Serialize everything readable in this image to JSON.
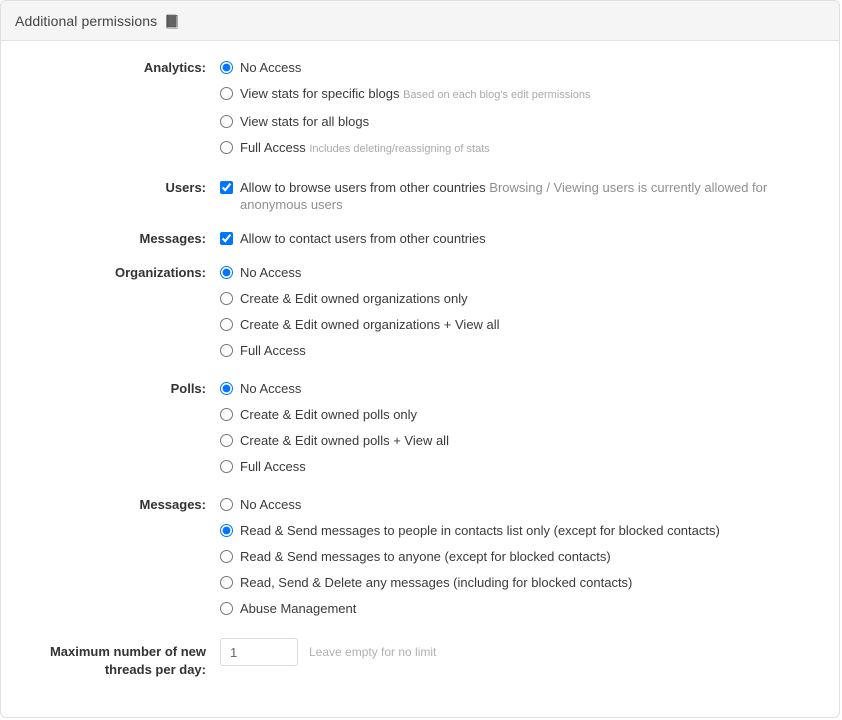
{
  "panel": {
    "title": "Additional permissions",
    "title_icon": "book-icon",
    "title_icon_glyph": "📕"
  },
  "groups": [
    {
      "label": "Analytics:",
      "type": "radio",
      "name": "analytics",
      "options": [
        {
          "text": "No Access",
          "hint": "",
          "checked": true
        },
        {
          "text": "View stats for specific blogs",
          "hint": "Based on each blog's edit permissions",
          "checked": false
        },
        {
          "text": "View stats for all blogs",
          "hint": "",
          "checked": false
        },
        {
          "text": "Full Access",
          "hint": "Includes deleting/reassigning of stats",
          "checked": false
        }
      ]
    },
    {
      "label": "Users:",
      "type": "checkbox",
      "name": "users",
      "options": [
        {
          "text": "Allow to browse users from other countries",
          "hint": "Browsing / Viewing users is currently allowed for anonymous users",
          "checked": true
        }
      ]
    },
    {
      "label": "Messages:",
      "type": "checkbox",
      "name": "messages_contact",
      "options": [
        {
          "text": "Allow to contact users from other countries",
          "hint": "",
          "checked": true
        }
      ]
    },
    {
      "label": "Organizations:",
      "type": "radio",
      "name": "organizations",
      "options": [
        {
          "text": "No Access",
          "hint": "",
          "checked": true
        },
        {
          "text": "Create & Edit owned organizations only",
          "hint": "",
          "checked": false
        },
        {
          "text": "Create & Edit owned organizations + View all",
          "hint": "",
          "checked": false
        },
        {
          "text": "Full Access",
          "hint": "",
          "checked": false
        }
      ]
    },
    {
      "label": "Polls:",
      "type": "radio",
      "name": "polls",
      "options": [
        {
          "text": "No Access",
          "hint": "",
          "checked": true
        },
        {
          "text": "Create & Edit owned polls only",
          "hint": "",
          "checked": false
        },
        {
          "text": "Create & Edit owned polls + View all",
          "hint": "",
          "checked": false
        },
        {
          "text": "Full Access",
          "hint": "",
          "checked": false
        }
      ]
    },
    {
      "label": "Messages:",
      "type": "radio",
      "name": "messages_access",
      "options": [
        {
          "text": "No Access",
          "hint": "",
          "checked": false
        },
        {
          "text": "Read & Send messages to people in contacts list only (except for blocked contacts)",
          "hint": "",
          "checked": true
        },
        {
          "text": "Read & Send messages to anyone (except for blocked contacts)",
          "hint": "",
          "checked": false
        },
        {
          "text": "Read, Send & Delete any messages (including for blocked contacts)",
          "hint": "",
          "checked": false
        },
        {
          "text": "Abuse Management",
          "hint": "",
          "checked": false
        }
      ]
    }
  ],
  "threads_field": {
    "label": "Maximum number of new threads per day:",
    "value": "1",
    "placeholder": "",
    "hint": "Leave empty for no limit"
  },
  "colors": {
    "header_bg": "#f5f5f5",
    "border": "#e0e0e0",
    "text": "#3a3a3a",
    "label": "#333333",
    "hint": "#aaaaaa"
  }
}
